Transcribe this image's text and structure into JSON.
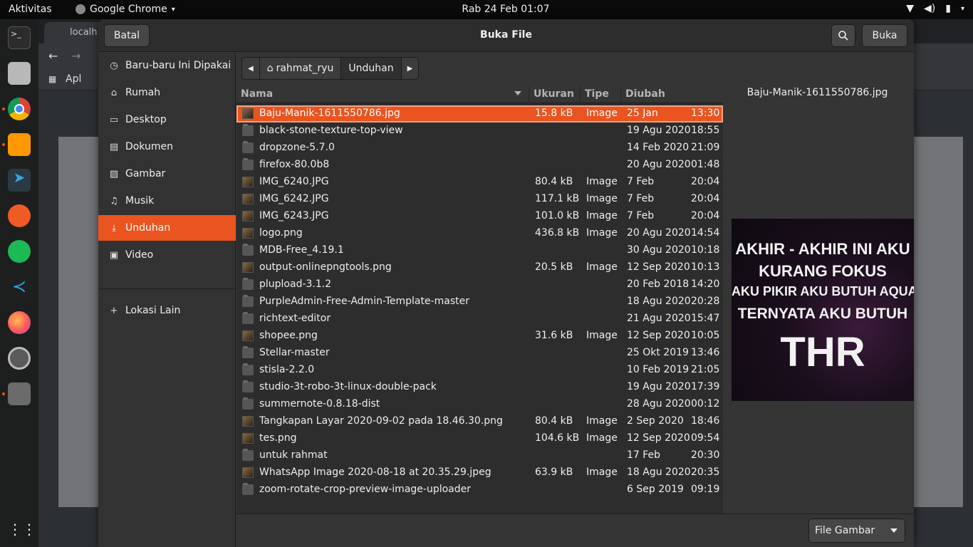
{
  "topbar": {
    "activities": "Aktivitas",
    "app_name": "Google Chrome",
    "clock": "Rab 24 Feb  01:07"
  },
  "browser": {
    "tab_title": "localh",
    "bookmark_apps": "Apl"
  },
  "dialog": {
    "title": "Buka File",
    "cancel_label": "Batal",
    "open_label": "Buka",
    "accent": "#e95420"
  },
  "sidebar": {
    "items": [
      {
        "label": "Baru-baru Ini Dipakai",
        "icon": "clock-icon"
      },
      {
        "label": "Rumah",
        "icon": "home-icon"
      },
      {
        "label": "Desktop",
        "icon": "desktop-icon"
      },
      {
        "label": "Dokumen",
        "icon": "document-icon"
      },
      {
        "label": "Gambar",
        "icon": "image-icon"
      },
      {
        "label": "Musik",
        "icon": "music-icon"
      },
      {
        "label": "Unduhan",
        "icon": "download-icon",
        "active": true
      },
      {
        "label": "Video",
        "icon": "video-icon"
      }
    ],
    "other_locations": "Lokasi Lain"
  },
  "pathbar": {
    "home": "rahmat_ryu",
    "current": "Unduhan"
  },
  "columns": {
    "name": "Nama",
    "size": "Ukuran",
    "type": "Tipe",
    "modified": "Diubah"
  },
  "files": [
    {
      "name": "Baju-Manik-1611550786.jpg",
      "size": "15.8 kB",
      "type": "Image",
      "date": "25 Jan",
      "time": "13:30",
      "kind": "image",
      "selected": true
    },
    {
      "name": "black-stone-texture-top-view",
      "size": "",
      "type": "",
      "date": "19 Agu 2020",
      "time": "18:55",
      "kind": "folder"
    },
    {
      "name": "dropzone-5.7.0",
      "size": "",
      "type": "",
      "date": "14 Feb 2020",
      "time": "21:09",
      "kind": "folder"
    },
    {
      "name": "firefox-80.0b8",
      "size": "",
      "type": "",
      "date": "20 Agu 2020",
      "time": "01:48",
      "kind": "folder"
    },
    {
      "name": "IMG_6240.JPG",
      "size": "80.4 kB",
      "type": "Image",
      "date": "7 Feb",
      "time": "20:04",
      "kind": "image"
    },
    {
      "name": "IMG_6242.JPG",
      "size": "117.1 kB",
      "type": "Image",
      "date": "7 Feb",
      "time": "20:04",
      "kind": "image"
    },
    {
      "name": "IMG_6243.JPG",
      "size": "101.0 kB",
      "type": "Image",
      "date": "7 Feb",
      "time": "20:04",
      "kind": "image"
    },
    {
      "name": "logo.png",
      "size": "436.8 kB",
      "type": "Image",
      "date": "20 Agu 2020",
      "time": "14:54",
      "kind": "image"
    },
    {
      "name": "MDB-Free_4.19.1",
      "size": "",
      "type": "",
      "date": "30 Agu 2020",
      "time": "10:18",
      "kind": "folder"
    },
    {
      "name": "output-onlinepngtools.png",
      "size": "20.5 kB",
      "type": "Image",
      "date": "12 Sep 2020",
      "time": "10:13",
      "kind": "image"
    },
    {
      "name": "plupload-3.1.2",
      "size": "",
      "type": "",
      "date": "20 Feb 2018",
      "time": "14:20",
      "kind": "folder"
    },
    {
      "name": "PurpleAdmin-Free-Admin-Template-master",
      "size": "",
      "type": "",
      "date": "18 Agu 2020",
      "time": "20:28",
      "kind": "folder"
    },
    {
      "name": "richtext-editor",
      "size": "",
      "type": "",
      "date": "21 Agu 2020",
      "time": "15:47",
      "kind": "folder"
    },
    {
      "name": "shopee.png",
      "size": "31.6 kB",
      "type": "Image",
      "date": "12 Sep 2020",
      "time": "10:05",
      "kind": "image"
    },
    {
      "name": "Stellar-master",
      "size": "",
      "type": "",
      "date": "25 Okt 2019",
      "time": "13:46",
      "kind": "folder"
    },
    {
      "name": "stisla-2.2.0",
      "size": "",
      "type": "",
      "date": "10 Feb 2019",
      "time": "21:05",
      "kind": "folder"
    },
    {
      "name": "studio-3t-robo-3t-linux-double-pack",
      "size": "",
      "type": "",
      "date": "19 Agu 2020",
      "time": "17:39",
      "kind": "folder"
    },
    {
      "name": "summernote-0.8.18-dist",
      "size": "",
      "type": "",
      "date": "28 Agu 2020",
      "time": "00:12",
      "kind": "folder"
    },
    {
      "name": "Tangkapan Layar 2020-09-02 pada 18.46.30.png",
      "size": "80.4 kB",
      "type": "Image",
      "date": "2 Sep 2020",
      "time": "18:46",
      "kind": "image"
    },
    {
      "name": "tes.png",
      "size": "104.6 kB",
      "type": "Image",
      "date": "12 Sep 2020",
      "time": "09:54",
      "kind": "image"
    },
    {
      "name": "untuk rahmat",
      "size": "",
      "type": "",
      "date": "17 Feb",
      "time": "20:30",
      "kind": "folder"
    },
    {
      "name": "WhatsApp Image 2020-08-18 at 20.35.29.jpeg",
      "size": "63.9 kB",
      "type": "Image",
      "date": "18 Agu 2020",
      "time": "20:35",
      "kind": "image"
    },
    {
      "name": "zoom-rotate-crop-preview-image-uploader",
      "size": "",
      "type": "",
      "date": "6 Sep 2019",
      "time": "09:19",
      "kind": "folder"
    }
  ],
  "preview": {
    "filename": "Baju-Manik-1611550786.jpg",
    "lines": [
      "AKHIR - AKHIR INI AKU",
      "KURANG FOKUS",
      "AKU PIKIR AKU BUTUH AQUA",
      "TERNYATA AKU BUTUH",
      "THR"
    ]
  },
  "filter": {
    "selected": "File Gambar"
  }
}
